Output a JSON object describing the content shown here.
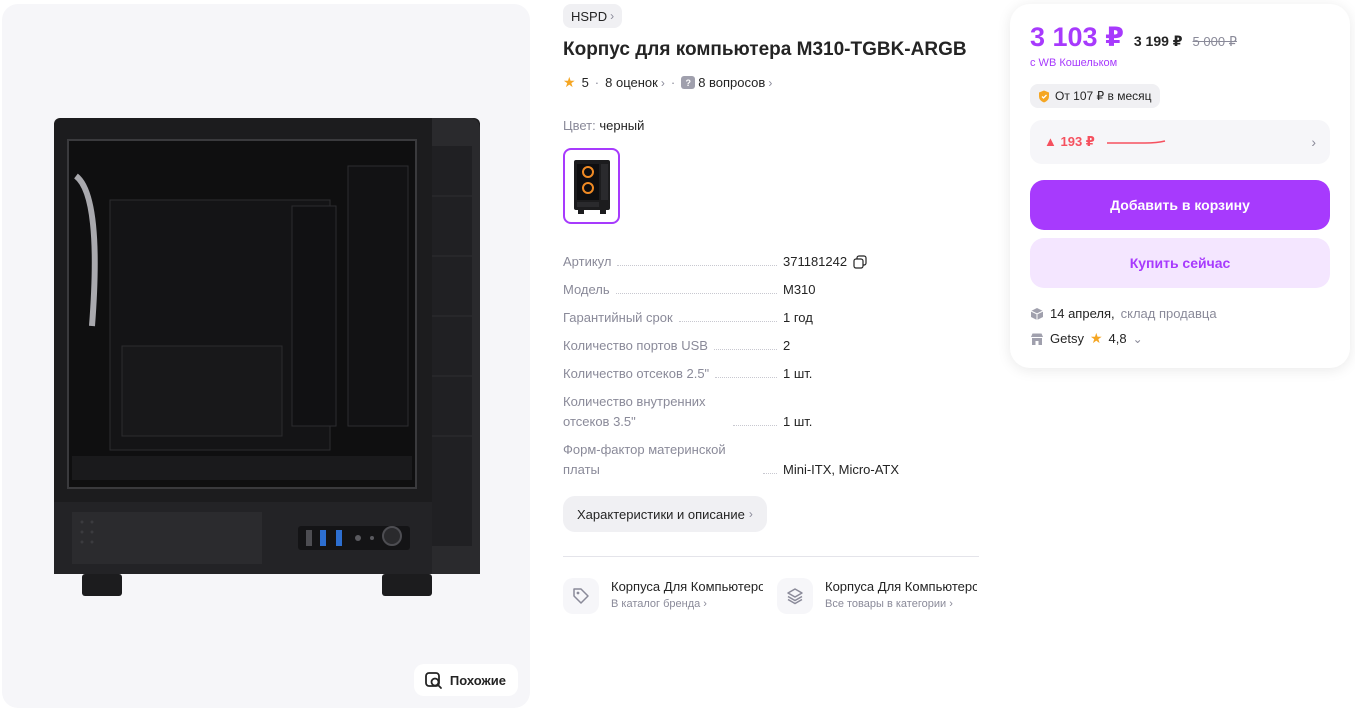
{
  "gallery": {
    "similar_label": "Похожие"
  },
  "product": {
    "brand": "HSPD",
    "title": "Корпус для компьютера M310-TGBK-ARGB",
    "rating": "5",
    "reviews": "8 оценок",
    "questions": "8 вопросов",
    "color_label": "Цвет:",
    "color_value": "черный"
  },
  "specs": [
    {
      "key": "Артикул",
      "value": "371181242"
    },
    {
      "key": "Модель",
      "value": "M310"
    },
    {
      "key": "Гарантийный срок",
      "value": "1 год"
    },
    {
      "key": "Количество портов USB",
      "value": "2"
    },
    {
      "key": "Количество отсеков 2.5\"",
      "value": "1 шт."
    },
    {
      "key": "Количество внутренних отсеков 3.5\"",
      "value": "1 шт."
    },
    {
      "key": "Форм-фактор материнской платы",
      "value": "Mini-ITX, Micro-ATX"
    }
  ],
  "chars_button": "Характеристики и описание",
  "categories": [
    {
      "title": "Корпуса Для Компьютеров",
      "sub": "В каталог бренда"
    },
    {
      "title": "Корпуса Для Компьютеров",
      "sub": "Все товары в категории"
    }
  ],
  "price": {
    "wallet_price": "3 103 ₽",
    "regular_price": "3 199 ₽",
    "old_price": "5 000 ₽",
    "wallet_note": "с WB Кошельком",
    "installment": "От 107 ₽ в месяц",
    "history_delta": "▲ 193 ₽",
    "add_to_cart": "Добавить в корзину",
    "buy_now": "Купить сейчас",
    "delivery_date": "14 апреля,",
    "delivery_source": "склад продавца",
    "seller_name": "Getsy",
    "seller_rating": "4,8"
  },
  "colors": {
    "accent": "#a73afd",
    "accent_light": "#f4e6ff",
    "price_up": "#f5515f",
    "star": "#f5a623"
  }
}
